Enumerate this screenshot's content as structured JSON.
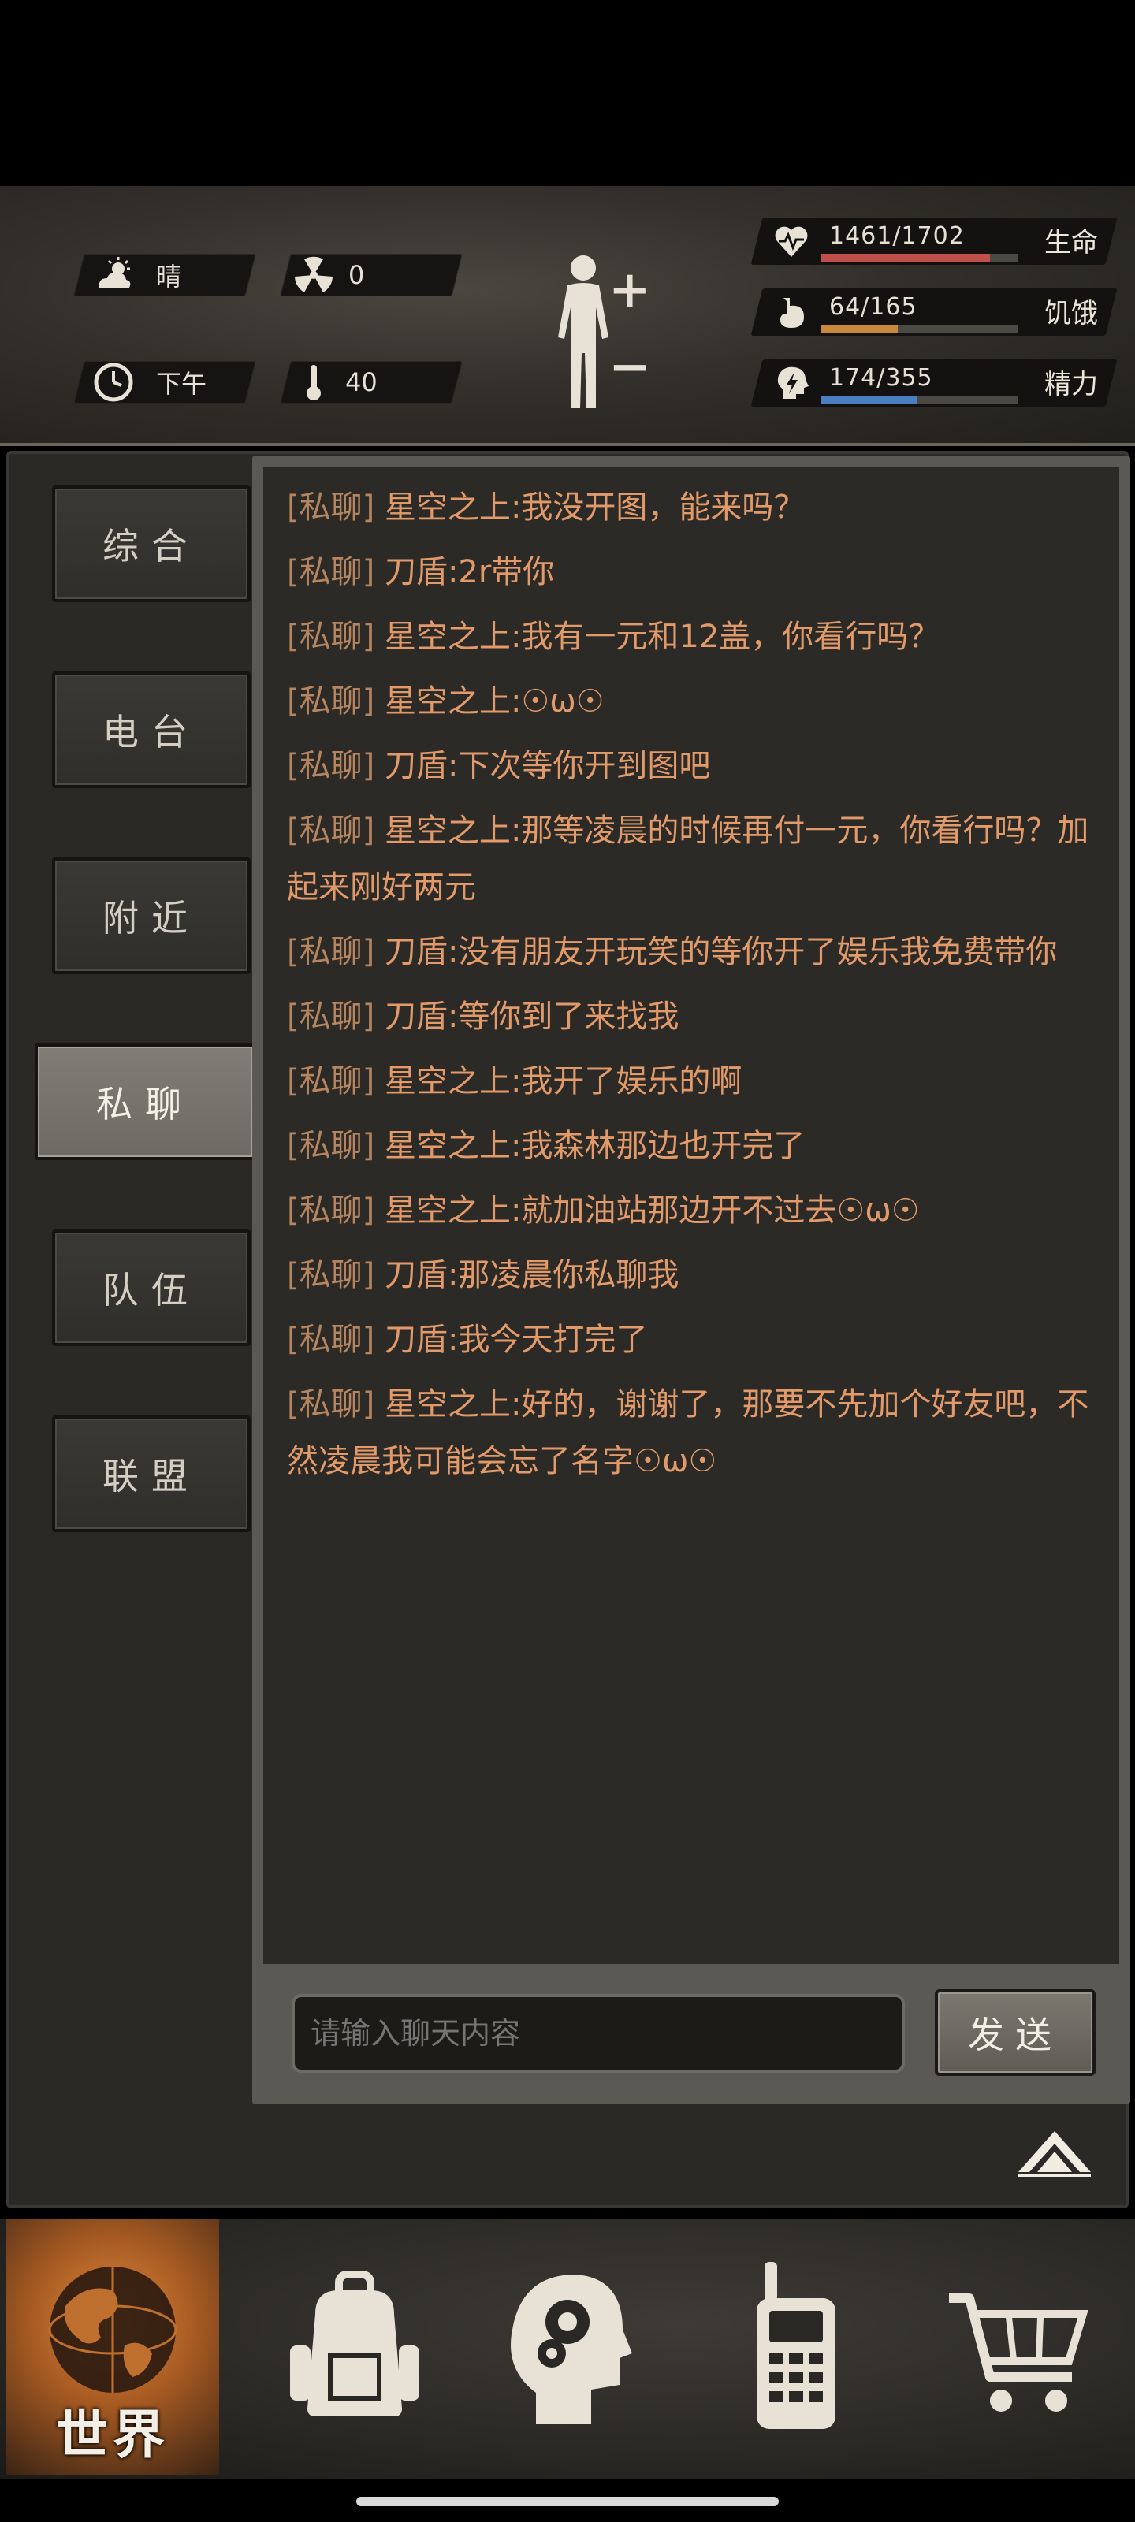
{
  "status": {
    "weather": "晴",
    "radiation": "0",
    "time_of_day": "下午",
    "temperature": "40"
  },
  "stats": [
    {
      "name": "life",
      "value": "1461/1702",
      "label": "生命",
      "fraction": 0.858,
      "color": "#c0504a",
      "icon": "heart-pulse-icon"
    },
    {
      "name": "hunger",
      "value": "64/165",
      "label": "饥饿",
      "fraction": 0.388,
      "color": "#c88a3a",
      "icon": "stomach-icon"
    },
    {
      "name": "energy",
      "value": "174/355",
      "label": "精力",
      "fraction": 0.49,
      "color": "#4b7fc0",
      "icon": "head-bolt-icon"
    }
  ],
  "tabs": [
    {
      "label": "综合",
      "active": false
    },
    {
      "label": "电台",
      "active": false
    },
    {
      "label": "附近",
      "active": false
    },
    {
      "label": "私聊",
      "active": true
    },
    {
      "label": "队伍",
      "active": false
    },
    {
      "label": "联盟",
      "active": false
    }
  ],
  "messages": [
    {
      "tag": "[私聊]",
      "sender": "星空之上",
      "text": ":我没开图，能来吗？"
    },
    {
      "tag": "[私聊]",
      "sender": "刀盾",
      "text": ":2r带你"
    },
    {
      "tag": "[私聊]",
      "sender": "星空之上",
      "text": ":我有一元和12盖，你看行吗？"
    },
    {
      "tag": "[私聊]",
      "sender": "星空之上",
      "text": ":☉ω☉"
    },
    {
      "tag": "[私聊]",
      "sender": "刀盾",
      "text": ":下次等你开到图吧"
    },
    {
      "tag": "[私聊]",
      "sender": "星空之上",
      "text": ":那等凌晨的时候再付一元，你看行吗？加起来刚好两元"
    },
    {
      "tag": "[私聊]",
      "sender": "刀盾",
      "text": ":没有朋友开玩笑的等你开了娱乐我免费带你"
    },
    {
      "tag": "[私聊]",
      "sender": "刀盾",
      "text": ":等你到了来找我"
    },
    {
      "tag": "[私聊]",
      "sender": "星空之上",
      "text": ":我开了娱乐的啊"
    },
    {
      "tag": "[私聊]",
      "sender": "星空之上",
      "text": ":我森林那边也开完了"
    },
    {
      "tag": "[私聊]",
      "sender": "星空之上",
      "text": ":就加油站那边开不过去☉ω☉"
    },
    {
      "tag": "[私聊]",
      "sender": "刀盾",
      "text": ":那凌晨你私聊我"
    },
    {
      "tag": "[私聊]",
      "sender": "刀盾",
      "text": ":我今天打完了"
    },
    {
      "tag": "[私聊]",
      "sender": "星空之上",
      "text": ":好的，谢谢了，那要不先加个好友吧，不然凌晨我可能会忘了名字☉ω☉"
    }
  ],
  "input": {
    "placeholder": "请输入聊天内容",
    "value": ""
  },
  "send_label": "发送",
  "nav": {
    "world_label": "世界",
    "items": [
      "backpack-icon",
      "brain-head-icon",
      "walkie-talkie-icon",
      "shopping-cart-icon"
    ]
  }
}
